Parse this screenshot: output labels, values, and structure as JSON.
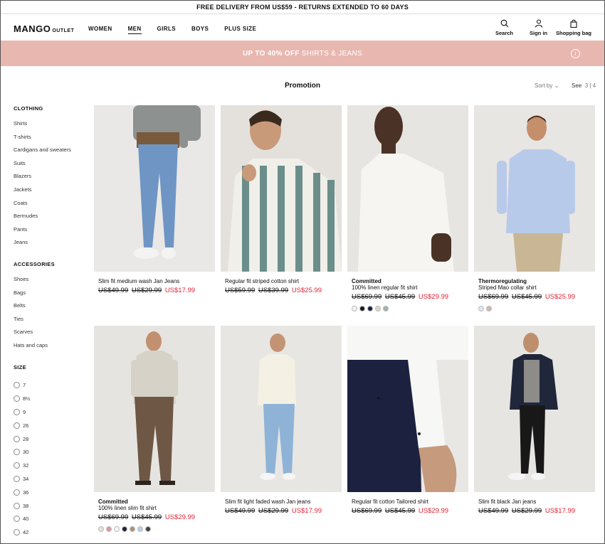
{
  "announcement": "FREE DELIVERY FROM US$59 - RETURNS EXTENDED TO 60 DAYS",
  "logo": {
    "main": "MANGO",
    "sub": "OUTLET"
  },
  "nav": [
    "WOMEN",
    "MEN",
    "GIRLS",
    "BOYS",
    "PLUS SIZE"
  ],
  "utilities": {
    "search": "Search",
    "signin": "Sign in",
    "bag": "Shopping bag"
  },
  "promo": {
    "bold": "UP TO 40% OFF",
    "rest": " SHIRTS & JEANS",
    "info": "i"
  },
  "page_title": "Promotion",
  "sort_label": "Sort by",
  "see": {
    "label": "See",
    "options": "3 | 4"
  },
  "sidebar": {
    "clothing_title": "CLOTHING",
    "clothing": [
      "Shirts",
      "T-shirts",
      "Cardigans and sweaters",
      "Suits",
      "Blazers",
      "Jackets",
      "Coats",
      "Bermudes",
      "Pants",
      "Jeans"
    ],
    "accessories_title": "ACCESSORIES",
    "accessories": [
      "Shoes",
      "Bags",
      "Belts",
      "Ties",
      "Scarves",
      "Hats and caps"
    ],
    "size_title": "SIZE",
    "sizes": [
      "7",
      "8½",
      "9",
      "26",
      "28",
      "30",
      "32",
      "34",
      "36",
      "38",
      "40",
      "42"
    ]
  },
  "products": [
    {
      "tag": "",
      "name": "Slim fit medium wash Jan Jeans",
      "old1": "US$49.99",
      "old2": "US$29.99",
      "sale": "US$17.99",
      "swatches": []
    },
    {
      "tag": "",
      "name": "Regular fit striped cotton shirt",
      "old1": "US$59.99",
      "old2": "US$39.99",
      "sale": "US$25.99",
      "swatches": []
    },
    {
      "tag": "Committed",
      "name": "100% linen regular fit shirt",
      "old1": "US$69.99",
      "old2": "US$45.99",
      "sale": "US$29.99",
      "swatches": [
        "#f2f2f2",
        "#1b1b1b",
        "#14213d",
        "#d9d6cf",
        "#9db3b0"
      ]
    },
    {
      "tag": "Thermoregulating",
      "name": "Striped Mao collar shirt",
      "old1": "US$69.99",
      "old2": "US$45.99",
      "sale": "US$25.99",
      "swatches": [
        "#dfe6f3",
        "#d8b2b2"
      ]
    },
    {
      "tag": "Committed",
      "name": "100% linen slim fit shirt",
      "old1": "US$69.99",
      "old2": "US$45.99",
      "sale": "US$29.99",
      "swatches": [
        "#e6e1d8",
        "#d99aa5",
        "#f5f5f5",
        "#1e2235",
        "#a8947b",
        "#b9d0e6",
        "#3d4a3c"
      ]
    },
    {
      "tag": "",
      "name": "Slim fit light faded wash Jan jeans",
      "old1": "US$49.99",
      "old2": "US$29.99",
      "sale": "US$17.99",
      "swatches": []
    },
    {
      "tag": "",
      "name": "Regular fit cotton Tailored shirt",
      "old1": "US$69.99",
      "old2": "US$45.99",
      "sale": "US$29.99",
      "swatches": []
    },
    {
      "tag": "",
      "name": "Slim fit black Jan jeans",
      "old1": "US$49.99",
      "old2": "US$29.99",
      "sale": "US$17.99",
      "swatches": []
    }
  ]
}
